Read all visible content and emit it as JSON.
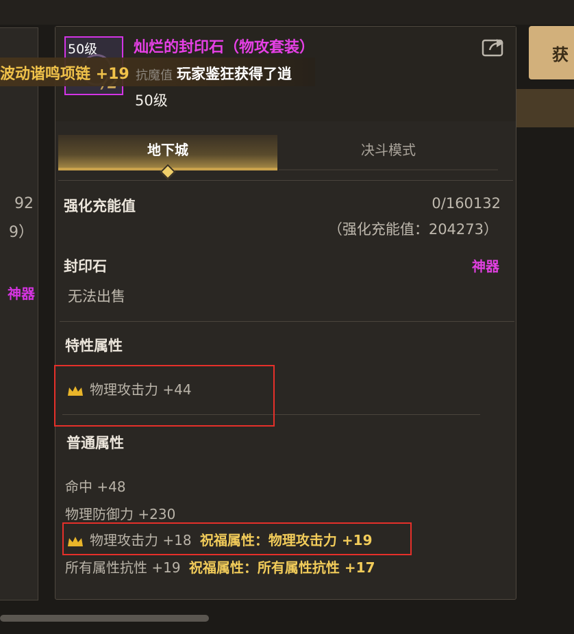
{
  "background": {
    "left_values": [
      "92",
      "9）"
    ],
    "left_tag": "神器",
    "right_button_label": "获"
  },
  "banner": {
    "item_text": "波动谐鸣项链 +19",
    "faint_text": "抗魔值",
    "message": "玩家鉴狂获得了逍"
  },
  "item": {
    "icon_level": "50级",
    "icon_tier": "/2",
    "name": "灿烂的封印石（物攻套装）",
    "level": "50级",
    "share_icon": "share-icon"
  },
  "tabs": {
    "dungeon": "地下城",
    "duel": "决斗模式",
    "active": "地下城"
  },
  "charge": {
    "label": "强化充能值",
    "value": "0/160132",
    "total": "（强化充能值：204273）"
  },
  "seal": {
    "label": "封印石",
    "tag": "神器",
    "sell": "无法出售"
  },
  "special": {
    "heading": "特性属性",
    "attr": "物理攻击力 +44"
  },
  "normal": {
    "heading": "普通属性",
    "hit": "命中 +48",
    "defense": "物理防御力 +230",
    "attack": "物理攻击力 +18",
    "attack_bless": "祝福属性：物理攻击力 +19",
    "resist": "所有属性抗性 +19",
    "resist_bless": "祝福属性：所有属性抗性 +17"
  },
  "colors": {
    "epic_pink": "#e640e6",
    "gold": "#f2cc5a",
    "highlight_red": "#e6302a",
    "tab_gold": "#c9a24c"
  }
}
